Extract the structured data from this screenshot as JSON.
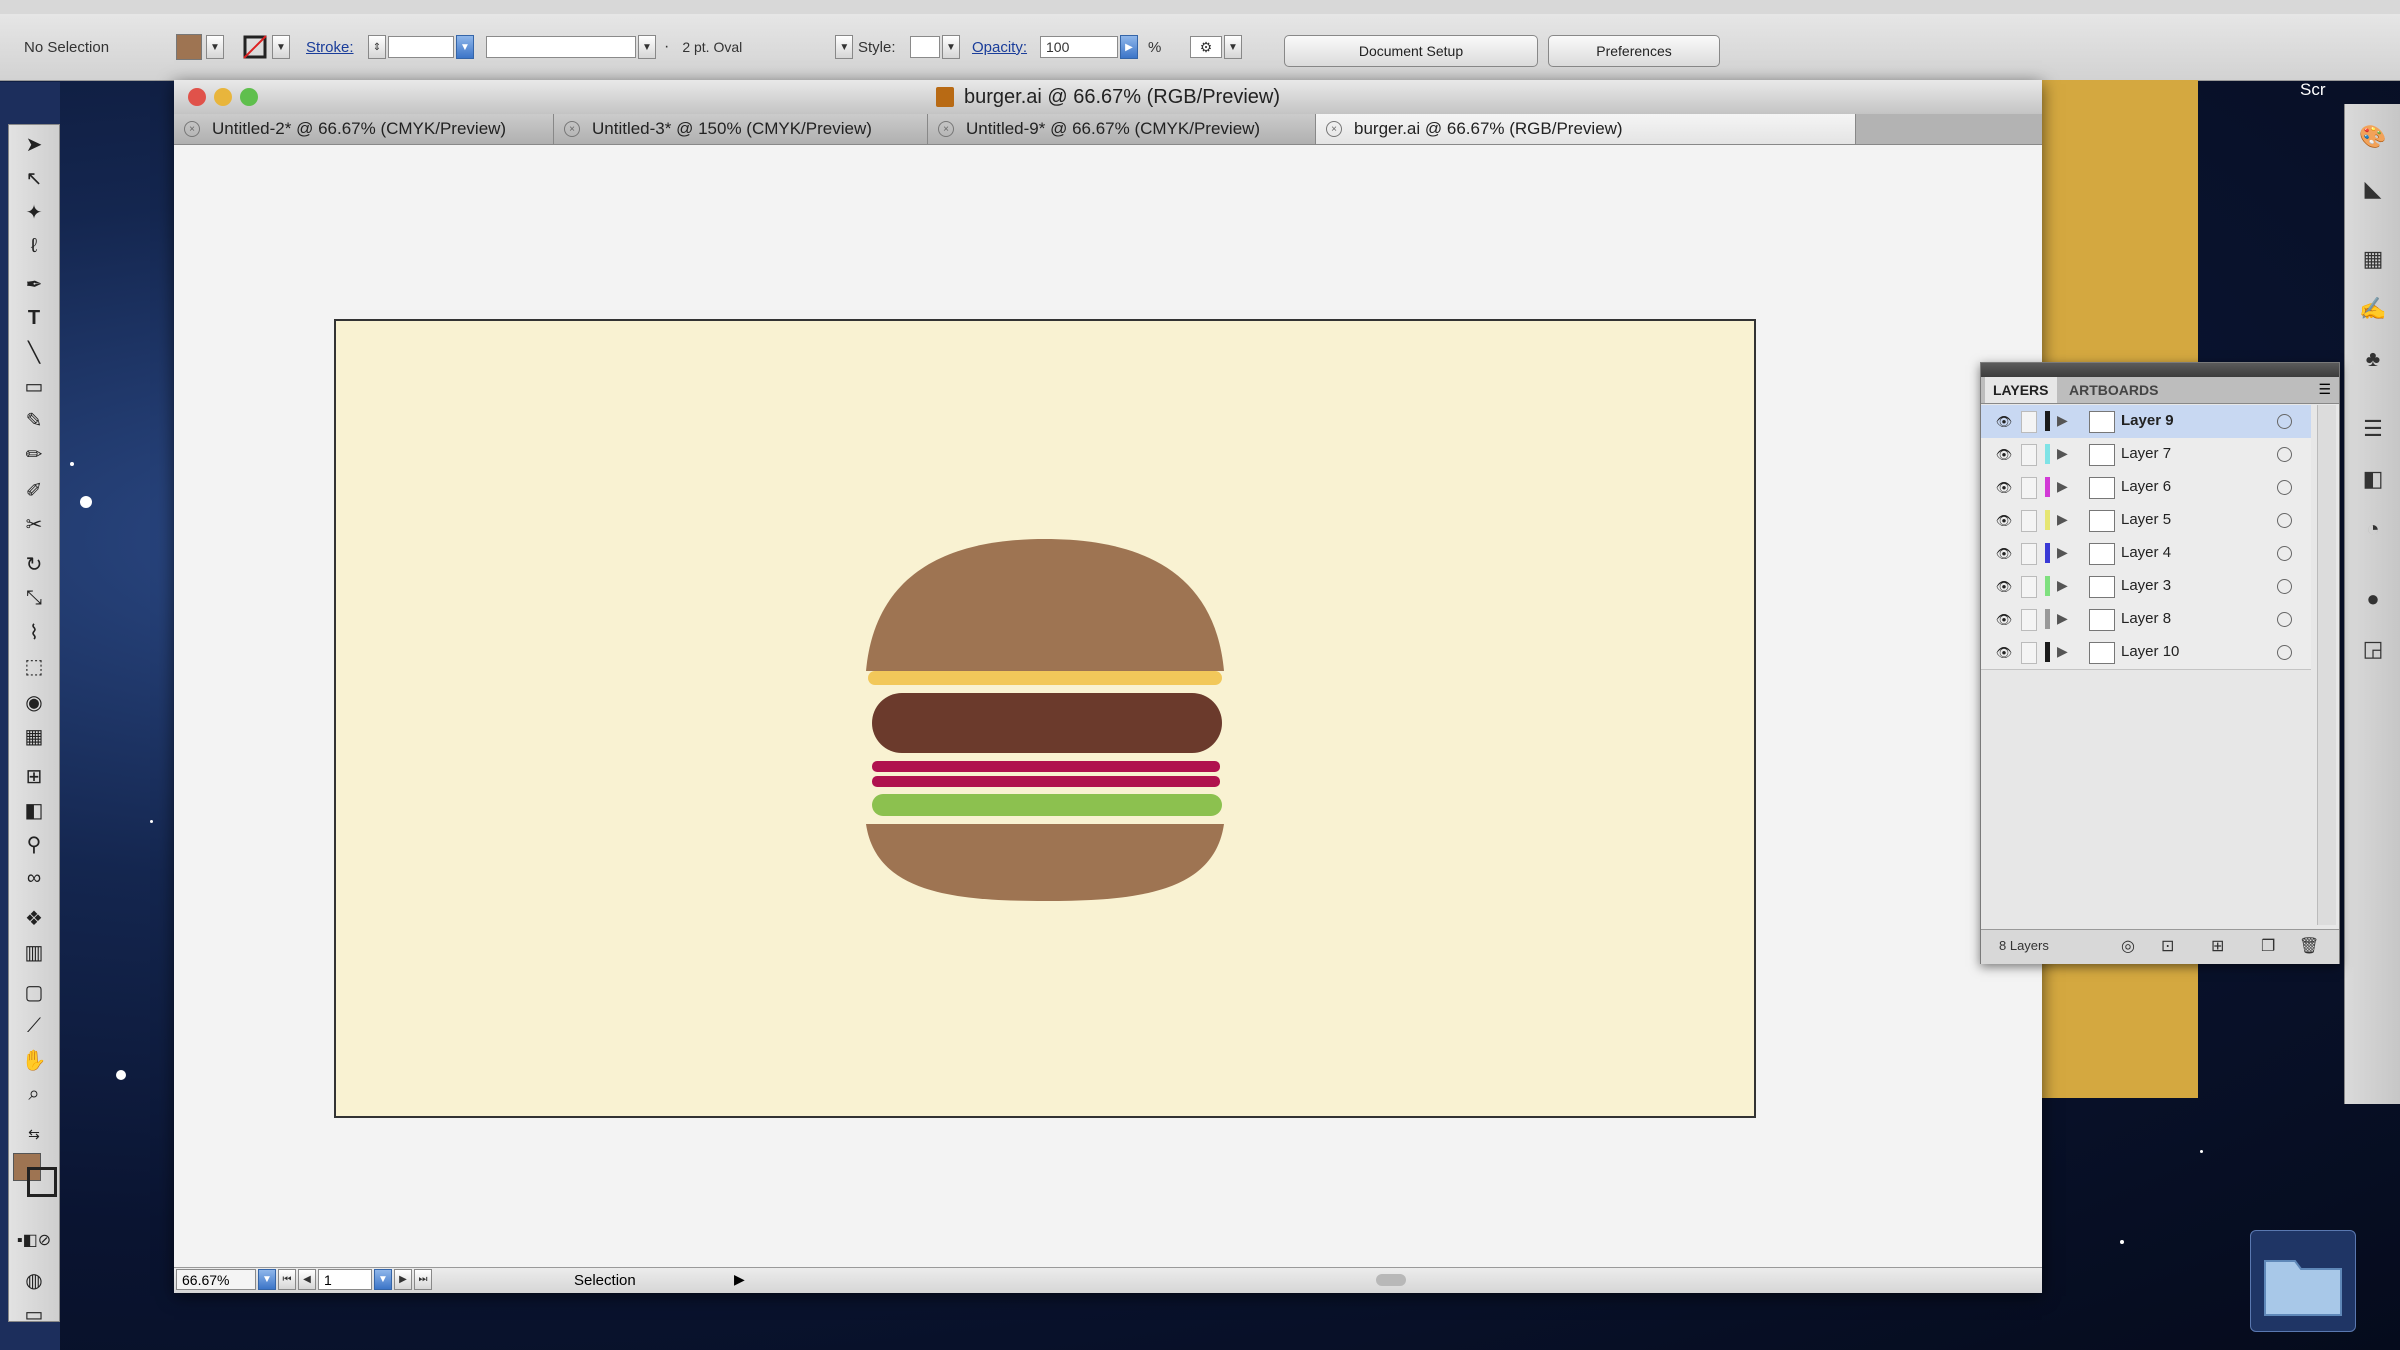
{
  "control_bar": {
    "selection_status": "No Selection",
    "stroke_label": "Stroke:",
    "brush_value": "2 pt. Oval",
    "style_label": "Style:",
    "opacity_label": "Opacity:",
    "opacity_value": "100",
    "opacity_unit": "%",
    "document_setup_label": "Document Setup",
    "preferences_label": "Preferences"
  },
  "window": {
    "title": "burger.ai @ 66.67% (RGB/Preview)",
    "tabs": [
      {
        "label": "Untitled-2* @ 66.67% (CMYK/Preview)"
      },
      {
        "label": "Untitled-3* @ 150% (CMYK/Preview)"
      },
      {
        "label": "Untitled-9* @ 66.67% (CMYK/Preview)"
      },
      {
        "label": "burger.ai @ 66.67% (RGB/Preview)",
        "active": true
      }
    ]
  },
  "status_bar": {
    "zoom": "66.67%",
    "artboard_number": "1",
    "tool_name": "Selection"
  },
  "desktop": {
    "corner_label": "Scr"
  },
  "layers_panel": {
    "tabs": [
      "LAYERS",
      "ARTBOARDS"
    ],
    "layers": [
      {
        "name": "Layer 9",
        "color": "#1a1a1a",
        "selected": true
      },
      {
        "name": "Layer 7",
        "color": "#7fe3e6"
      },
      {
        "name": "Layer 6",
        "color": "#d23ad6"
      },
      {
        "name": "Layer 5",
        "color": "#e6e673"
      },
      {
        "name": "Layer 4",
        "color": "#3a3ad6"
      },
      {
        "name": "Layer 3",
        "color": "#7fe07f"
      },
      {
        "name": "Layer 8",
        "color": "#999999"
      },
      {
        "name": "Layer 10",
        "color": "#1a1a1a"
      }
    ],
    "footer_count": "8 Layers"
  },
  "artwork": {
    "colors": {
      "bun": "#9e7452",
      "cheese": "#f2c85a",
      "patty": "#6b3a2c",
      "ketchup": "#b0124e",
      "lettuce": "#8cc14f",
      "artboard": "#f9f2d2"
    }
  },
  "colors": {
    "fill_swatch": "#9e7452"
  }
}
